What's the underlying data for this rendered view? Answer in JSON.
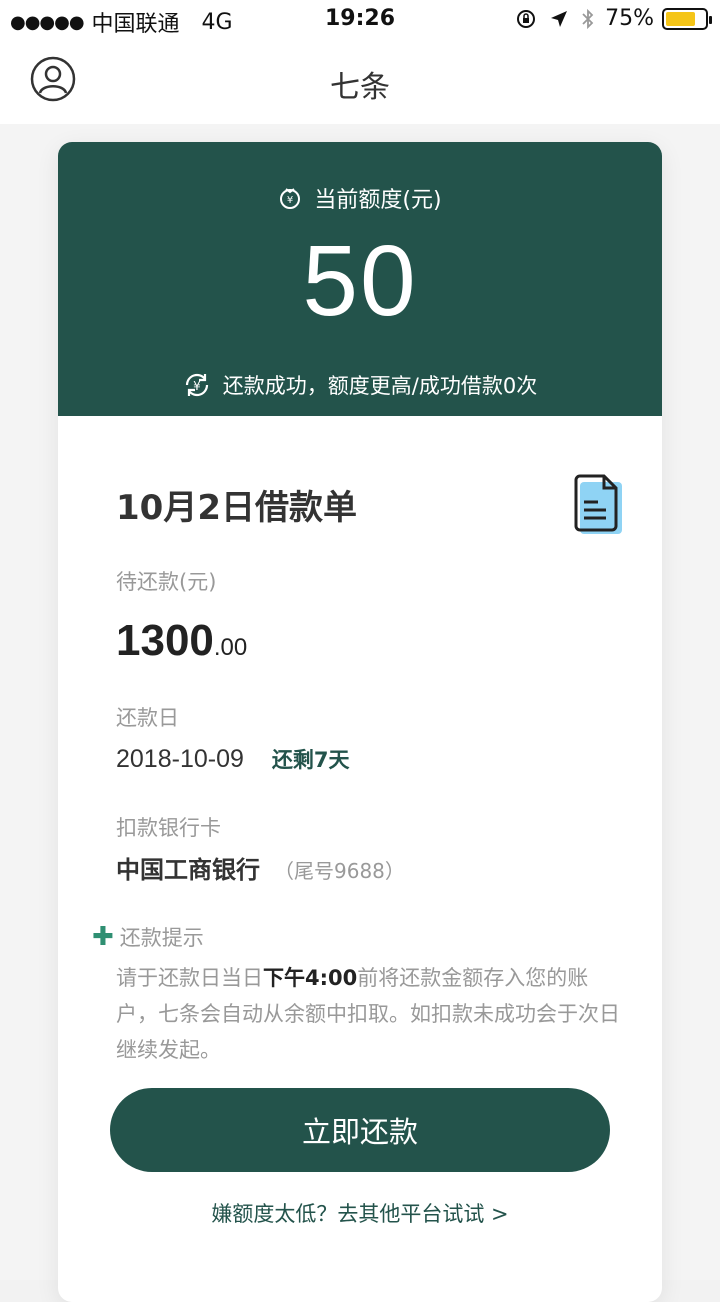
{
  "status_bar": {
    "signal": "●●●●●",
    "carrier": "中国联通",
    "network": "4G",
    "time": "19:26",
    "battery": "75%"
  },
  "nav": {
    "title": "七条",
    "avatar_icon": "user-circle-icon"
  },
  "quota": {
    "label": "当前额度(元)",
    "value": "50",
    "note": "还款成功，额度更高/成功借款0次"
  },
  "bill": {
    "title": "10月2日借款单",
    "due_label": "待还款(元)",
    "amount_int": "1300",
    "amount_dec": ".00",
    "date_label": "还款日",
    "date": "2018-10-09",
    "remaining": "还剩7天",
    "bank_label": "扣款银行卡",
    "bank": "中国工商银行",
    "bank_tail": "（尾号9688）",
    "tip_title": "还款提示",
    "tip_pre": "请于还款日当日",
    "tip_bold": "下午4:00",
    "tip_post": "前将还款金额存入您的账户，七条会自动从余额中扣取。如扣款未成功会于次日继续发起。"
  },
  "actions": {
    "pay_label": "立即还款",
    "other_link": "嫌额度太低？去其他平台试试 >"
  },
  "colors": {
    "primary": "#23534b",
    "accent_green": "#2f8f72",
    "battery": "#f5c518",
    "doc_icon_fill": "#8fd3f4"
  },
  "battery_level": 0.75
}
